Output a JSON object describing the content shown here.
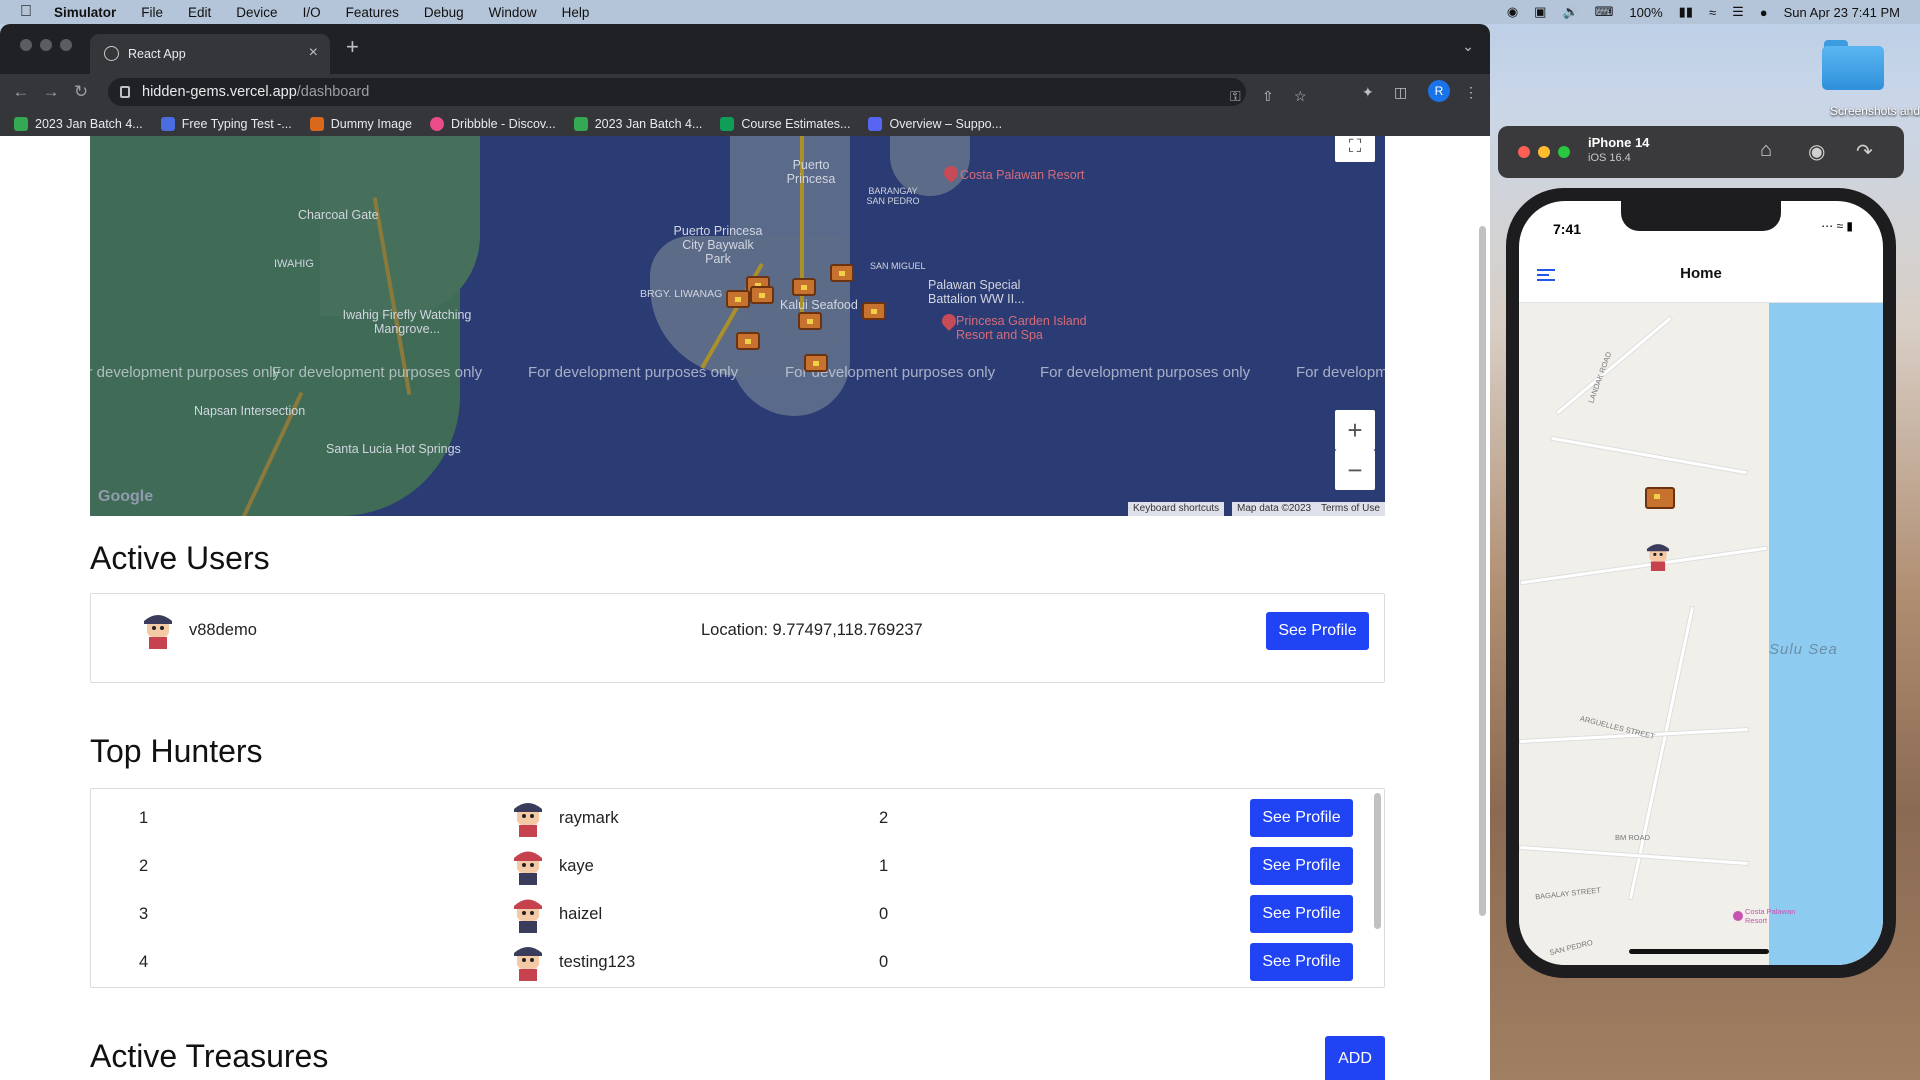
{
  "menubar": {
    "app": "Simulator",
    "items": [
      "File",
      "Edit",
      "Device",
      "I/O",
      "Features",
      "Debug",
      "Window",
      "Help"
    ],
    "battery": "100%",
    "datetime": "Sun Apr 23  7:41 PM"
  },
  "desktop": {
    "folder_label": "Screenshots and"
  },
  "browser": {
    "tab_title": "React App",
    "url_host": "hidden-gems.vercel.app",
    "url_path": "/dashboard",
    "profile_initial": "R",
    "bookmarks": [
      {
        "label": "2023 Jan Batch 4...",
        "color": "#34a853"
      },
      {
        "label": "Free Typing Test -...",
        "color": "#4a6ee0"
      },
      {
        "label": "Dummy Image",
        "color": "#d9681b"
      },
      {
        "label": "Dribbble - Discov...",
        "color": "#ea4c89"
      },
      {
        "label": "2023 Jan Batch 4...",
        "color": "#34a853"
      },
      {
        "label": "Course Estimates...",
        "color": "#0f9d58"
      },
      {
        "label": "Overview – Suppo...",
        "color": "#5865f2"
      }
    ]
  },
  "map": {
    "labels": {
      "puerto_princesa": "Puerto Princesa",
      "barangay_san_pedro": "BARANGAY SAN PEDRO",
      "costa_palawan": "Costa Palawan Resort",
      "charcoal_gate": "Charcoal Gate",
      "baywalk": "Puerto Princesa City Baywalk Park",
      "iwahig": "IWAHIG",
      "san_miguel": "SAN MIGUEL",
      "brgy_liwanag": "BRGY. LIWANAG",
      "special_battalion": "Palawan Special Battalion WW II...",
      "kalui": "Kalui Seafood",
      "princesa_garden": "Princesa Garden Island Resort and Spa",
      "iwahig_firefly": "Iwahig Firefly Watching Mangrove...",
      "napsan": "Napsan Intersection",
      "santa_lucia": "Santa Lucia Hot Springs"
    },
    "watermark": "For development purposes only",
    "google": "Google",
    "keyboard_shortcuts": "Keyboard shortcuts",
    "map_data": "Map data ©2023",
    "terms": "Terms of Use"
  },
  "active_users": {
    "title": "Active Users",
    "users": [
      {
        "name": "v88demo",
        "location": "Location: 9.77497,118.769237",
        "button": "See Profile"
      }
    ]
  },
  "top_hunters": {
    "title": "Top Hunters",
    "rows": [
      {
        "rank": "1",
        "name": "raymark",
        "score": "2",
        "button": "See Profile"
      },
      {
        "rank": "2",
        "name": "kaye",
        "score": "1",
        "button": "See Profile"
      },
      {
        "rank": "3",
        "name": "haizel",
        "score": "0",
        "button": "See Profile"
      },
      {
        "rank": "4",
        "name": "testing123",
        "score": "0",
        "button": "See Profile"
      }
    ]
  },
  "active_treasures": {
    "title": "Active Treasures",
    "add_button": "ADD"
  },
  "simulator": {
    "device": "iPhone 14",
    "os": "iOS 16.4",
    "time": "7:41",
    "header_title": "Home",
    "sea_label": "Sulu Sea",
    "streets": [
      "LANDAK ROAD",
      "ARGUELLES STREET",
      "BM ROAD",
      "BAGALAY STREET",
      "SAN PEDRO"
    ],
    "poi": "Costa Palawan Resort"
  }
}
